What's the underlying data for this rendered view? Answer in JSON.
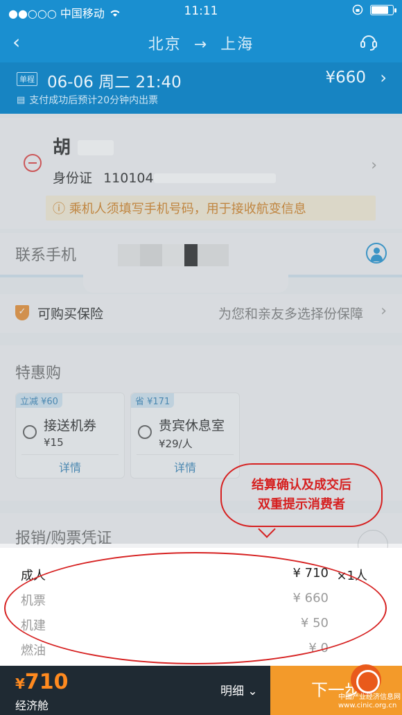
{
  "status": {
    "carrier": "●●○○○ 中国移动",
    "time": "11:11"
  },
  "nav": {
    "back": "‹",
    "from": "北京",
    "to": "上海",
    "arrow": "→"
  },
  "flight": {
    "badge": "单程",
    "date": "06-06 周二 21:40",
    "price": "¥660",
    "note": "支付成功后预计20分钟内出票"
  },
  "passenger": {
    "name": "胡",
    "id_label": "身份证",
    "id_prefix": "110104",
    "warning": "ⓘ 乘机人须填写手机号码，用于接收航变信息"
  },
  "contact": {
    "label": "联系手机"
  },
  "insurance": {
    "label": "可购买保险",
    "hint": "为您和亲友多选择份保障"
  },
  "deals": {
    "title": "特惠购",
    "items": [
      {
        "tag": "立减 ¥60",
        "name": "接送机券",
        "price": "¥15",
        "more": "详情"
      },
      {
        "tag": "省 ¥171",
        "name": "贵宾休息室",
        "price": "¥29/人",
        "more": "详情"
      }
    ]
  },
  "receipt": {
    "label": "报销/购票凭证"
  },
  "annotation": {
    "line1": "结算确认及成交后",
    "line2": "双重提示消费者"
  },
  "details": {
    "rows": [
      {
        "label": "成人",
        "value": "¥ 710",
        "qty": "×1人"
      },
      {
        "label": "机票",
        "value": "¥ 660"
      },
      {
        "label": "机建",
        "value": "¥ 50"
      },
      {
        "label": "燃油",
        "value": "¥ 0"
      }
    ]
  },
  "bottom": {
    "currency": "¥",
    "amount": "710",
    "cabin": "经济舱",
    "detail": "明细",
    "next": "下一步"
  },
  "watermark": {
    "line1": "中国产业经济信息网",
    "line2": "www.cinic.org.cn"
  },
  "colors": {
    "primary": "#1a8fd0",
    "accent": "#f39a2a",
    "annotation": "#d62020"
  }
}
